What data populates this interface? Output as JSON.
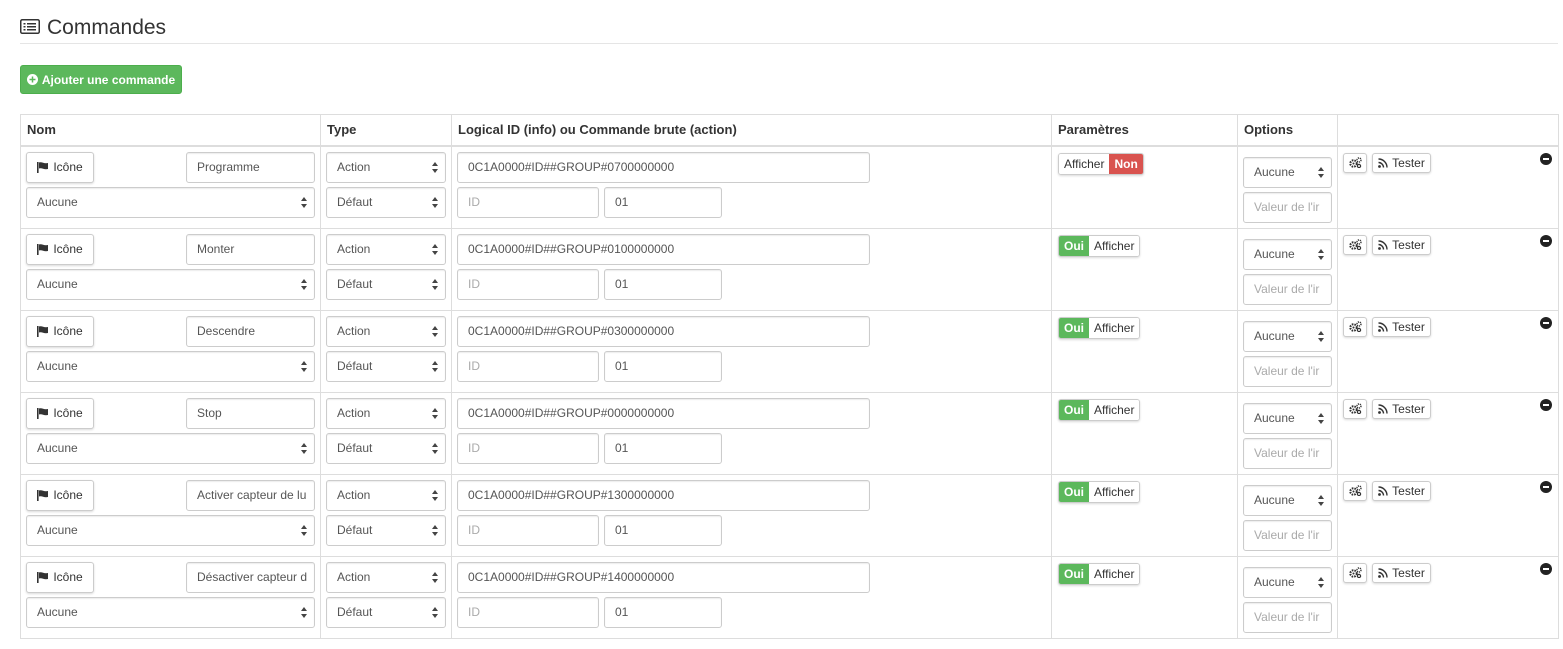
{
  "header": {
    "title": "Commandes"
  },
  "toolbar": {
    "add_label": "Ajouter une commande"
  },
  "table": {
    "headers": [
      "Nom",
      "Type",
      "Logical ID (info) ou Commande brute (action)",
      "Paramètres",
      "Options",
      ""
    ]
  },
  "rows": [
    {
      "icon_label": "Icône",
      "name": "Programme",
      "unit": "Aucune",
      "type": "Action",
      "subtype": "Défaut",
      "logical_id": "0C1A0000#ID##GROUP#0700000000",
      "id_placeholder": "ID",
      "id_value": "01",
      "toggle_first": "Afficher",
      "toggle_second": "Non",
      "option_select": "Aucune",
      "value_placeholder": "Valeur de l'ir",
      "test_label": "Tester"
    },
    {
      "icon_label": "Icône",
      "name": "Monter",
      "unit": "Aucune",
      "type": "Action",
      "subtype": "Défaut",
      "logical_id": "0C1A0000#ID##GROUP#0100000000",
      "id_placeholder": "ID",
      "id_value": "01",
      "toggle_first": "Oui",
      "toggle_second": "Afficher",
      "option_select": "Aucune",
      "value_placeholder": "Valeur de l'ir",
      "test_label": "Tester"
    },
    {
      "icon_label": "Icône",
      "name": "Descendre",
      "unit": "Aucune",
      "type": "Action",
      "subtype": "Défaut",
      "logical_id": "0C1A0000#ID##GROUP#0300000000",
      "id_placeholder": "ID",
      "id_value": "01",
      "toggle_first": "Oui",
      "toggle_second": "Afficher",
      "option_select": "Aucune",
      "value_placeholder": "Valeur de l'ir",
      "test_label": "Tester"
    },
    {
      "icon_label": "Icône",
      "name": "Stop",
      "unit": "Aucune",
      "type": "Action",
      "subtype": "Défaut",
      "logical_id": "0C1A0000#ID##GROUP#0000000000",
      "id_placeholder": "ID",
      "id_value": "01",
      "toggle_first": "Oui",
      "toggle_second": "Afficher",
      "option_select": "Aucune",
      "value_placeholder": "Valeur de l'ir",
      "test_label": "Tester"
    },
    {
      "icon_label": "Icône",
      "name": "Activer capteur de lu",
      "unit": "Aucune",
      "type": "Action",
      "subtype": "Défaut",
      "logical_id": "0C1A0000#ID##GROUP#1300000000",
      "id_placeholder": "ID",
      "id_value": "01",
      "toggle_first": "Oui",
      "toggle_second": "Afficher",
      "option_select": "Aucune",
      "value_placeholder": "Valeur de l'ir",
      "test_label": "Tester"
    },
    {
      "icon_label": "Icône",
      "name": "Désactiver capteur d",
      "unit": "Aucune",
      "type": "Action",
      "subtype": "Défaut",
      "logical_id": "0C1A0000#ID##GROUP#1400000000",
      "id_placeholder": "ID",
      "id_value": "01",
      "toggle_first": "Oui",
      "toggle_second": "Afficher",
      "option_select": "Aucune",
      "value_placeholder": "Valeur de l'ir",
      "test_label": "Tester"
    }
  ],
  "colors": {
    "success": "#5cb85c",
    "danger": "#d9534f",
    "border": "#dddddd"
  }
}
